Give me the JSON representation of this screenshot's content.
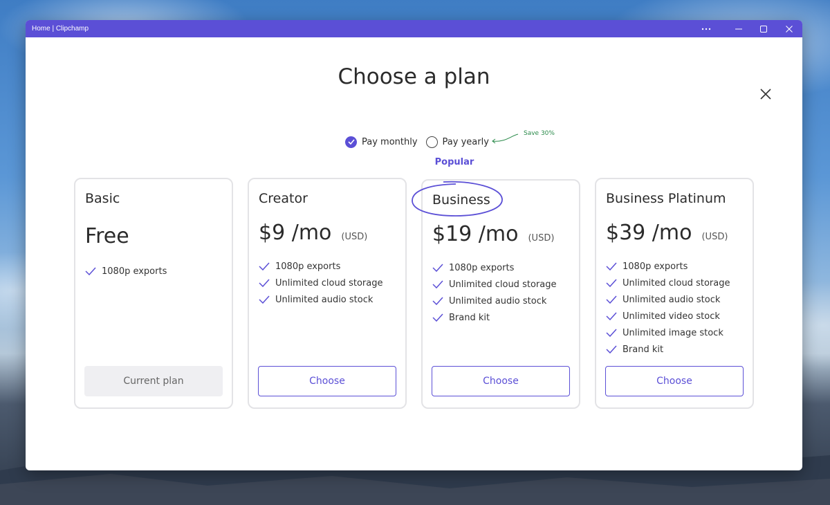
{
  "window": {
    "title": "Home | Clipchamp"
  },
  "dialog": {
    "heading": "Choose a plan"
  },
  "billing": {
    "monthly_label": "Pay monthly",
    "yearly_label": "Pay yearly",
    "selected": "monthly",
    "save_note": "Save 30%"
  },
  "popular_label": "Popular",
  "plans": [
    {
      "name": "Basic",
      "price": "Free",
      "currency": "",
      "features": [
        "1080p exports"
      ],
      "button_label": "Current plan"
    },
    {
      "name": "Creator",
      "price": "$9 /mo",
      "currency": "(USD)",
      "features": [
        "1080p exports",
        "Unlimited cloud storage",
        "Unlimited audio stock"
      ],
      "button_label": "Choose"
    },
    {
      "name": "Business",
      "price": "$19 /mo",
      "currency": "(USD)",
      "features": [
        "1080p exports",
        "Unlimited cloud storage",
        "Unlimited audio stock",
        "Brand kit"
      ],
      "button_label": "Choose"
    },
    {
      "name": "Business Platinum",
      "price": "$39 /mo",
      "currency": "(USD)",
      "features": [
        "1080p exports",
        "Unlimited cloud storage",
        "Unlimited audio stock",
        "Unlimited video stock",
        "Unlimited image stock",
        "Brand kit"
      ],
      "button_label": "Choose"
    }
  ],
  "icons": {
    "check": "check-icon",
    "close": "close-icon",
    "minimize": "minimize-icon",
    "maximize": "maximize-icon",
    "more": "more-icon"
  },
  "colors": {
    "accent": "#5b4fd6",
    "save_note": "#2a8a4a"
  }
}
